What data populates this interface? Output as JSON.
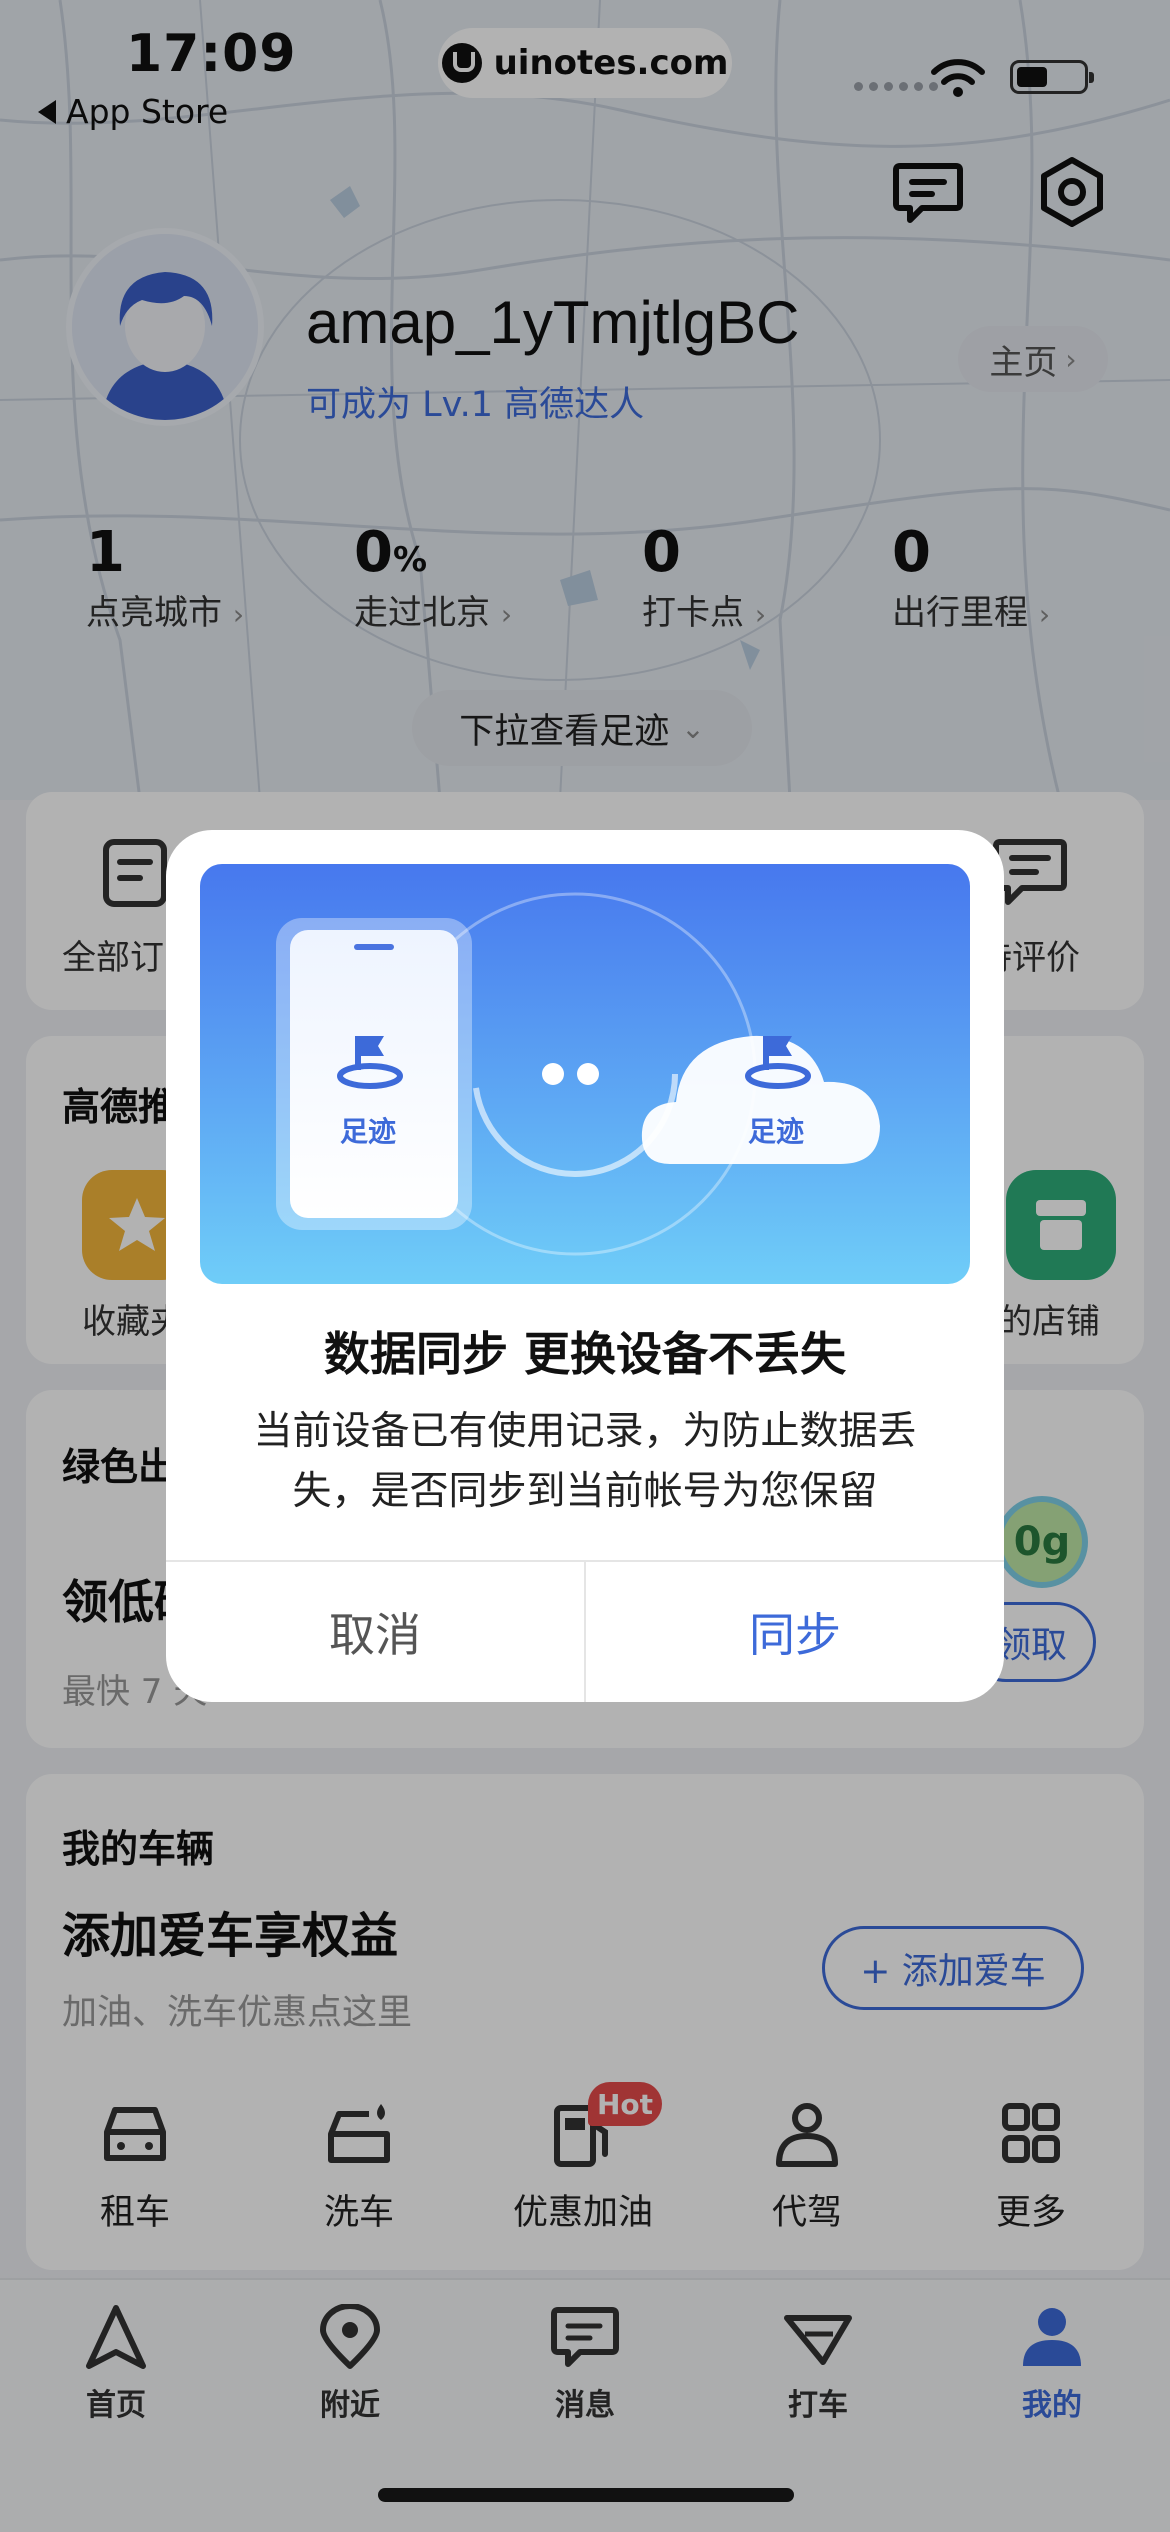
{
  "status_bar": {
    "time": "17:09",
    "back_label": "App Store",
    "url": "uinotes.com"
  },
  "profile": {
    "username": "amap_1yTmjtlgBC",
    "level_text": "可成为 Lv.1 高德达人",
    "home_label": "主页"
  },
  "stats": [
    {
      "value": "1",
      "unit": "",
      "label": "点亮城市"
    },
    {
      "value": "0",
      "unit": "%",
      "label": "走过北京"
    },
    {
      "value": "0",
      "unit": "",
      "label": "打卡点"
    },
    {
      "value": "0",
      "unit": "",
      "label": "出行里程"
    }
  ],
  "pull_label": "下拉查看足迹",
  "orders_card": {
    "left_label": "全部订",
    "right_label": "待评价"
  },
  "recommend_card": {
    "title": "高德推",
    "left_label": "收藏夹",
    "right_label": "的店铺"
  },
  "green_card": {
    "title": "绿色出",
    "headline": "领低碳",
    "sub": "最快 7 天",
    "badge": "0g",
    "claim": "领取"
  },
  "vehicle_card": {
    "title": "我的车辆",
    "headline": "添加爱车享权益",
    "sub": "加油、洗车优惠点这里",
    "add_button": "+ 添加爱车"
  },
  "services": [
    {
      "label": "租车",
      "icon": "car-rental-icon"
    },
    {
      "label": "洗车",
      "icon": "car-wash-icon"
    },
    {
      "label": "优惠加油",
      "icon": "fuel-icon",
      "badge": "Hot"
    },
    {
      "label": "代驾",
      "icon": "driver-icon"
    },
    {
      "label": "更多",
      "icon": "more-grid-icon"
    }
  ],
  "tabs": [
    {
      "label": "首页",
      "icon": "navigate-icon",
      "active": false
    },
    {
      "label": "附近",
      "icon": "location-pin-icon",
      "active": false
    },
    {
      "label": "消息",
      "icon": "message-icon",
      "active": false
    },
    {
      "label": "打车",
      "icon": "taxi-icon",
      "active": false
    },
    {
      "label": "我的",
      "icon": "person-icon",
      "active": true
    }
  ],
  "dialog": {
    "phone_label": "足迹",
    "cloud_label": "足迹",
    "title": "数据同步 更换设备不丢失",
    "body": "当前设备已有使用记录，为防止数据丢失，是否同步到当前帐号为您保留",
    "cancel_label": "取消",
    "confirm_label": "同步"
  },
  "colors": {
    "accent": "#3d6ad9",
    "hot": "#e54b4b",
    "overlay": "rgba(0,0,0,0.30)"
  }
}
